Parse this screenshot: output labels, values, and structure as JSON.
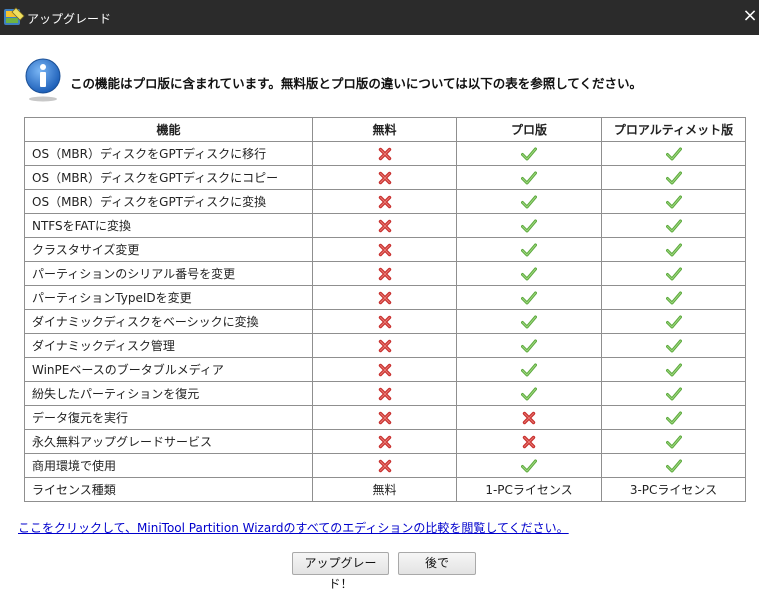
{
  "window": {
    "title": "アップグレード",
    "close_label": "×"
  },
  "message": "この機能はプロ版に含まれています。無料版とプロ版の違いについては以下の表を参照してください。",
  "table": {
    "headers": [
      "機能",
      "無料",
      "プロ版",
      "プロアルティメット版"
    ],
    "rows": [
      {
        "feature": "OS（MBR）ディスクをGPTディスクに移行",
        "free": "cross",
        "pro": "check",
        "ultimate": "check"
      },
      {
        "feature": "OS（MBR）ディスクをGPTディスクにコピー",
        "free": "cross",
        "pro": "check",
        "ultimate": "check"
      },
      {
        "feature": "OS（MBR）ディスクをGPTディスクに変換",
        "free": "cross",
        "pro": "check",
        "ultimate": "check"
      },
      {
        "feature": "NTFSをFATに変換",
        "free": "cross",
        "pro": "check",
        "ultimate": "check"
      },
      {
        "feature": "クラスタサイズ変更",
        "free": "cross",
        "pro": "check",
        "ultimate": "check"
      },
      {
        "feature": "パーティションのシリアル番号を変更",
        "free": "cross",
        "pro": "check",
        "ultimate": "check"
      },
      {
        "feature": "パーティションTypeIDを変更",
        "free": "cross",
        "pro": "check",
        "ultimate": "check"
      },
      {
        "feature": "ダイナミックディスクをベーシックに変換",
        "free": "cross",
        "pro": "check",
        "ultimate": "check"
      },
      {
        "feature": "ダイナミックディスク管理",
        "free": "cross",
        "pro": "check",
        "ultimate": "check"
      },
      {
        "feature": "WinPEベースのブータブルメディア",
        "free": "cross",
        "pro": "check",
        "ultimate": "check"
      },
      {
        "feature": "紛失したパーティションを復元",
        "free": "cross",
        "pro": "check",
        "ultimate": "check"
      },
      {
        "feature": "データ復元を実行",
        "free": "cross",
        "pro": "cross",
        "ultimate": "check"
      },
      {
        "feature": "永久無料アップグレードサービス",
        "free": "cross",
        "pro": "cross",
        "ultimate": "check"
      },
      {
        "feature": "商用環境で使用",
        "free": "cross",
        "pro": "check",
        "ultimate": "check"
      }
    ],
    "license_row": {
      "feature": "ライセンス種類",
      "free": "無料",
      "pro": "1-PCライセンス",
      "ultimate": "3-PCライセンス"
    }
  },
  "link_text": "ここをクリックして、MiniTool Partition Wizardのすべてのエディションの比較を閲覧してください。",
  "buttons": {
    "upgrade": "アップグレード！",
    "later": "後で"
  },
  "colors": {
    "check": "#5aa83c",
    "cross": "#c8302f",
    "link": "#0000cc",
    "titlebar": "#2b2b2b"
  },
  "icons": {
    "app": "partition-wizard-icon",
    "info": "info-icon",
    "check": "check-icon",
    "cross": "cross-icon",
    "close": "close-icon"
  }
}
